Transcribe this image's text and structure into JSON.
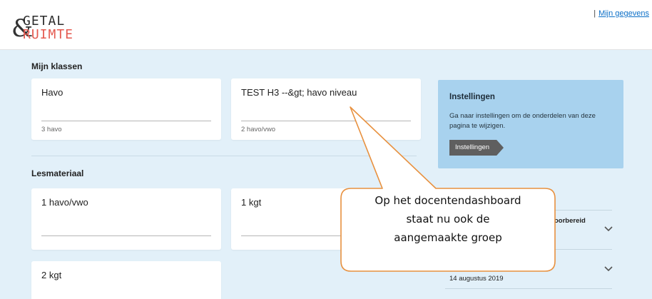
{
  "header": {
    "logo_line1": "GETAL",
    "logo_line2": "RUIMTE",
    "logo_amp": "&",
    "separator": "|",
    "account_link": "Mijn gegevens"
  },
  "klassen": {
    "title": "Mijn klassen",
    "cards": [
      {
        "name": "Havo",
        "sub": "3 havo"
      },
      {
        "name": "TEST H3 --&gt; havo niveau",
        "sub": "2 havo/vwo"
      }
    ]
  },
  "lesmateriaal": {
    "title": "Lesmateriaal",
    "cards": [
      {
        "name": "1 havo/vwo"
      },
      {
        "name": "1 kgt"
      },
      {
        "name": "2 kgt"
      }
    ]
  },
  "settings": {
    "title": "Instellingen",
    "text": "Ga naar instellingen om de onderdelen van deze pagina te wijzigen.",
    "button": "Instellingen"
  },
  "side_list": {
    "item1_partial": "oorbereid",
    "item2_date": "14 augustus 2019"
  },
  "callout": {
    "line1": "Op het docentendashboard",
    "line2": "staat nu ook de",
    "line3": "aangemaakte groep"
  },
  "colors": {
    "accent_red": "#e45a50",
    "link": "#0b6fc7",
    "page_bg": "#e2f0f9",
    "settings_bg": "#a8d2ee",
    "callout_border": "#e8913f"
  },
  "icons": [
    "chevron-down-icon",
    "chevron-down-icon"
  ]
}
